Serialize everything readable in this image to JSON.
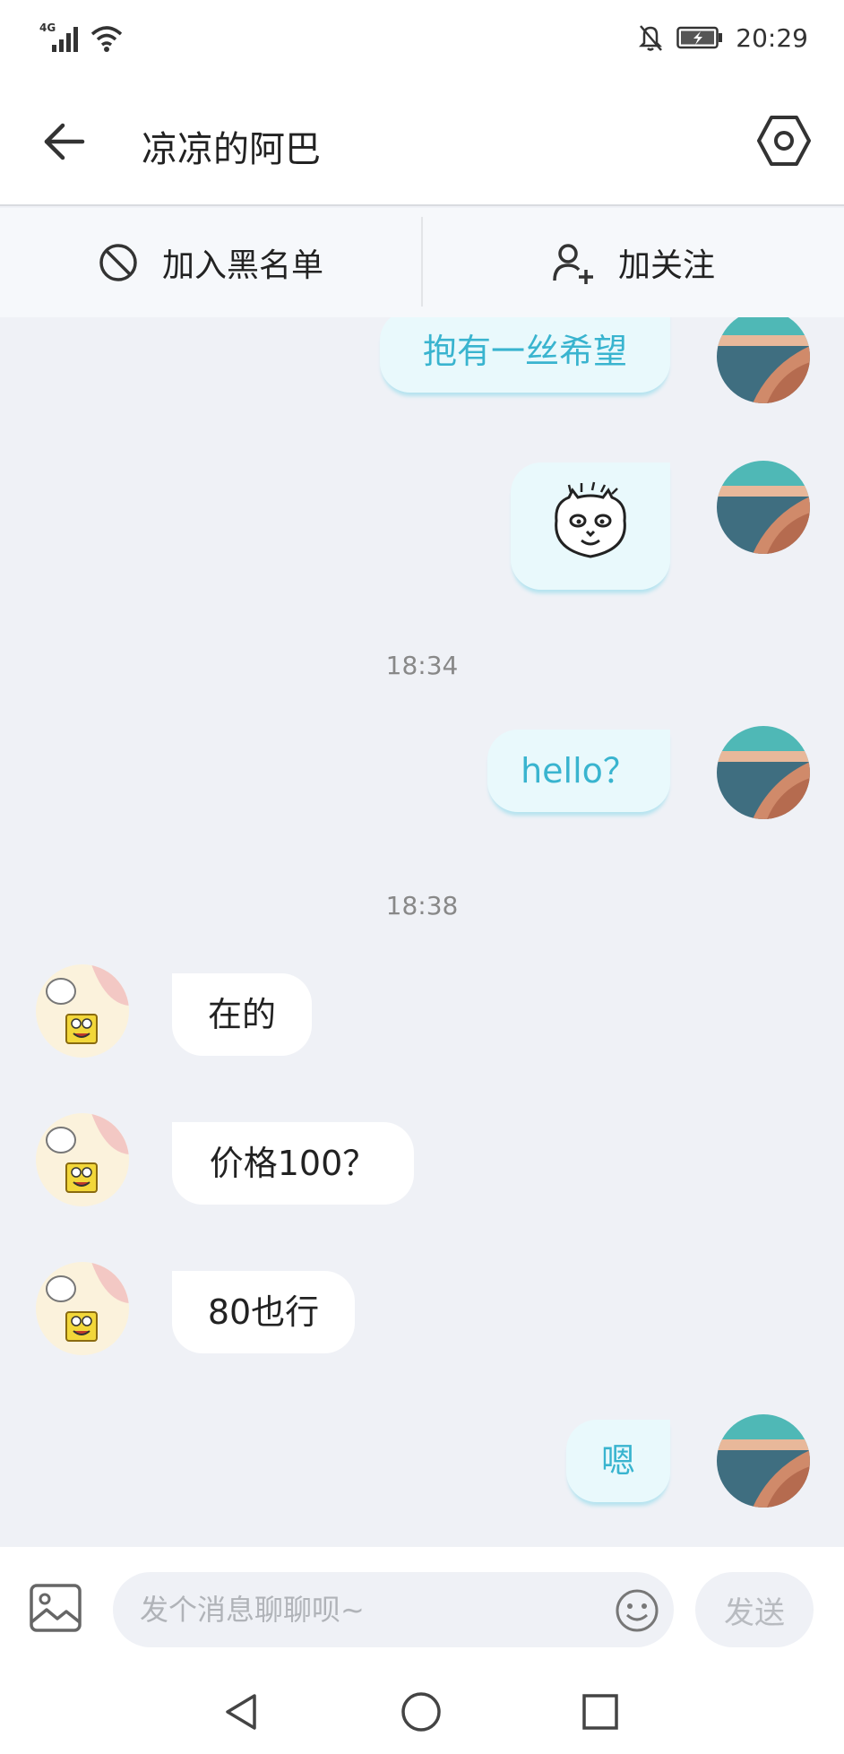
{
  "status_bar": {
    "network": "4G",
    "time": "20:29"
  },
  "header": {
    "title": "凉凉的阿巴"
  },
  "actions": {
    "blacklist_label": "加入黑名单",
    "follow_label": "加关注"
  },
  "messages": {
    "m1": "抱有一丝希望",
    "m3": "hello？",
    "m4": "在的",
    "m5": "价格100？",
    "m6": "80也行",
    "m7": "嗯"
  },
  "timestamps": {
    "t1": "18:34",
    "t2": "18:38"
  },
  "input_bar": {
    "placeholder": "发个消息聊聊呗~",
    "send_label": "发送"
  },
  "colors": {
    "accent": "#39b4cf",
    "self_bubble": "#e9f9fc",
    "chat_bg": "#eff1f6"
  },
  "icons": {
    "back": "back-arrow-icon",
    "settings": "hexagon-settings-icon",
    "blacklist": "block-icon",
    "follow": "add-user-icon",
    "image": "image-icon",
    "emoji": "smiley-icon",
    "nav_back": "triangle-back-icon",
    "nav_home": "circle-home-icon",
    "nav_recent": "square-recent-icon"
  }
}
